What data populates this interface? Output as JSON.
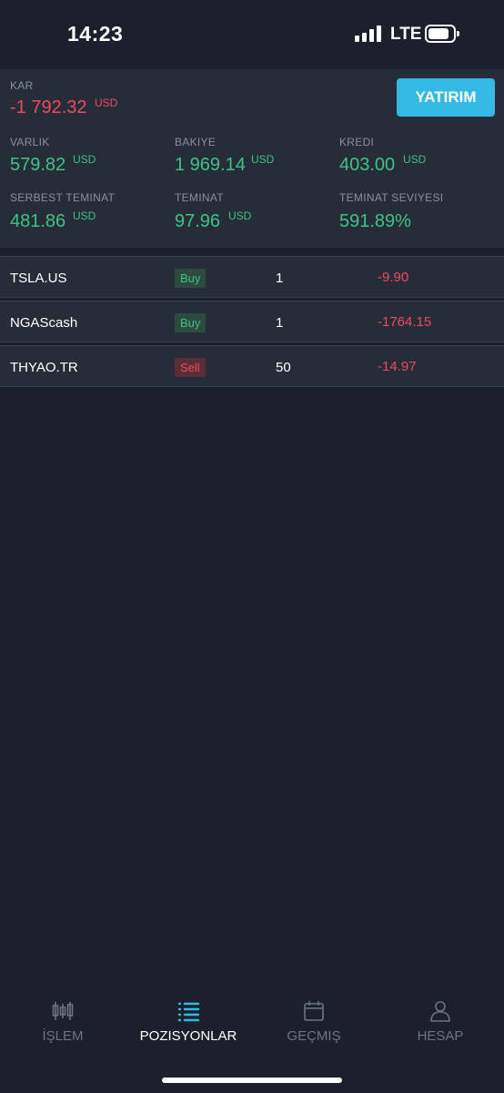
{
  "status_bar": {
    "time": "14:23",
    "network": "LTE"
  },
  "summary": {
    "deposit_button": "YATIRIM",
    "profit": {
      "label": "KAR",
      "value": "-1 792.32",
      "currency": "USD"
    },
    "equity": {
      "label": "VARLIK",
      "value": "579.82",
      "currency": "USD"
    },
    "balance": {
      "label": "BAKIYE",
      "value": "1 969.14",
      "currency": "USD"
    },
    "credit": {
      "label": "KREDI",
      "value": "403.00",
      "currency": "USD"
    },
    "free_margin": {
      "label": "SERBEST TEMINAT",
      "value": "481.86",
      "currency": "USD"
    },
    "margin": {
      "label": "TEMINAT",
      "value": "97.96",
      "currency": "USD"
    },
    "margin_level": {
      "label": "TEMINAT SEVIYESI",
      "value": "591.89%"
    }
  },
  "positions": [
    {
      "symbol": "TSLA.US",
      "side": "Buy",
      "quantity": "1",
      "pnl": "-9.90"
    },
    {
      "symbol": "NGAScash",
      "side": "Buy",
      "quantity": "1",
      "pnl": "-1764.15"
    },
    {
      "symbol": "THYAO.TR",
      "side": "Sell",
      "quantity": "50",
      "pnl": "-14.97"
    }
  ],
  "tabs": [
    {
      "label": "İŞLEM",
      "icon": "candlestick-chart-icon"
    },
    {
      "label": "POZISYONLAR",
      "icon": "list-icon",
      "active": true
    },
    {
      "label": "GEÇMIŞ",
      "icon": "calendar-icon"
    },
    {
      "label": "HESAP",
      "icon": "user-icon"
    }
  ],
  "colors": {
    "background": "#1c202c",
    "panel": "#272c39",
    "positive": "#3cc484",
    "negative": "#ef4a5c",
    "accent": "#34b8e4"
  }
}
